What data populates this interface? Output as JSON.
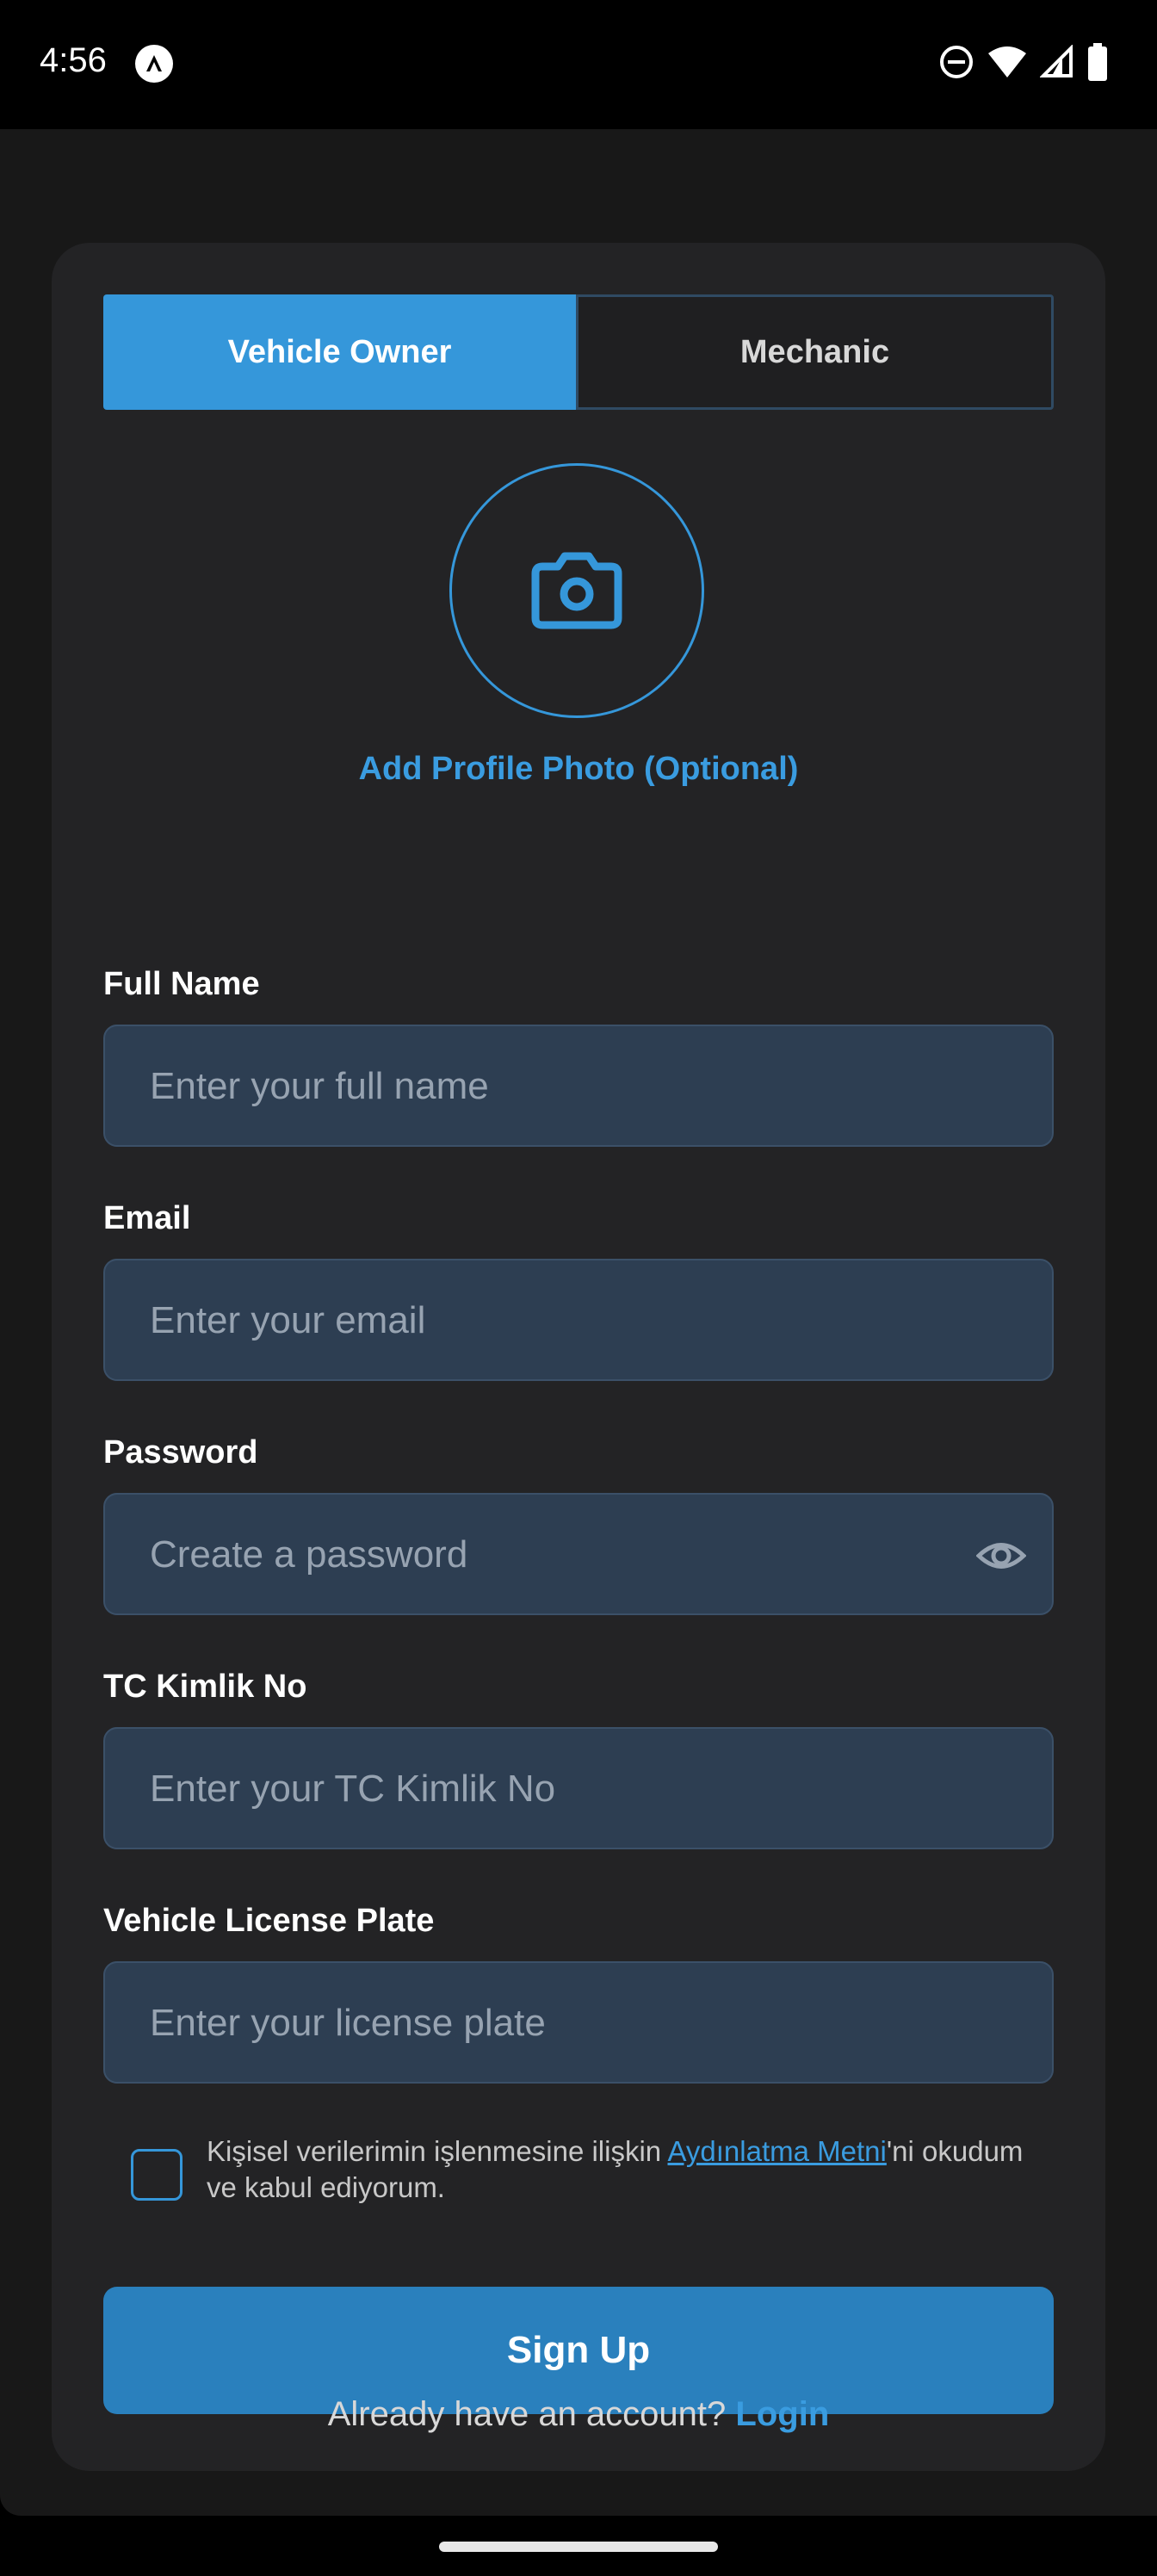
{
  "status_bar": {
    "time": "4:56"
  },
  "tabs": [
    {
      "label": "Vehicle Owner",
      "active": true
    },
    {
      "label": "Mechanic",
      "active": false
    }
  ],
  "profile_photo": {
    "label": "Add Profile Photo (Optional)",
    "icon": "camera-icon"
  },
  "form": {
    "full_name": {
      "label": "Full Name",
      "placeholder": "Enter your full name",
      "value": ""
    },
    "email": {
      "label": "Email",
      "placeholder": "Enter your email",
      "value": ""
    },
    "password": {
      "label": "Password",
      "placeholder": "Create a password",
      "value": ""
    },
    "tc_kimlik": {
      "label": "TC Kimlik No",
      "placeholder": "Enter your TC Kimlik No",
      "value": ""
    },
    "license_plate": {
      "label": "Vehicle License Plate",
      "placeholder": "Enter your license plate",
      "value": ""
    }
  },
  "consent": {
    "text_before": "Kişisel verilerimin işlenmesine ilişkin ",
    "link": "Aydınlatma Metni",
    "text_after": "'ni okudum ve kabul ediyorum.",
    "checked": false
  },
  "actions": {
    "signup_label": "Sign Up",
    "login_prompt": "Already have an account?",
    "login_link": "Login"
  },
  "colors": {
    "accent": "#3597da",
    "background": "#181818",
    "card": "#232325",
    "input_bg": "#2d3e52"
  }
}
